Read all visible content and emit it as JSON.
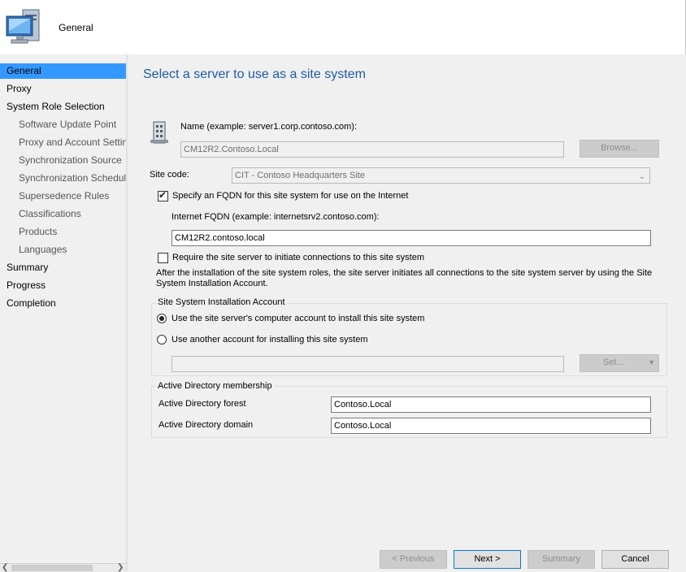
{
  "header": {
    "title": "General",
    "icon": "computer-monitor-icon"
  },
  "nav": {
    "items": [
      {
        "label": "General",
        "level": "top",
        "selected": true
      },
      {
        "label": "Proxy",
        "level": "top",
        "selected": false
      },
      {
        "label": "System Role Selection",
        "level": "top",
        "selected": false
      },
      {
        "label": "Software Update Point",
        "level": "sub",
        "selected": false
      },
      {
        "label": "Proxy and Account Settin",
        "level": "sub",
        "selected": false
      },
      {
        "label": "Synchronization Source",
        "level": "sub",
        "selected": false
      },
      {
        "label": "Synchronization Schedule",
        "level": "sub",
        "selected": false
      },
      {
        "label": "Supersedence Rules",
        "level": "sub",
        "selected": false
      },
      {
        "label": "Classifications",
        "level": "sub",
        "selected": false
      },
      {
        "label": "Products",
        "level": "sub",
        "selected": false
      },
      {
        "label": "Languages",
        "level": "sub",
        "selected": false
      },
      {
        "label": "Summary",
        "level": "top",
        "selected": false
      },
      {
        "label": "Progress",
        "level": "top",
        "selected": false
      },
      {
        "label": "Completion",
        "level": "top",
        "selected": false
      }
    ],
    "scroll_thumb_label": "III"
  },
  "main": {
    "heading": "Select a server to use as a site system",
    "name_label": "Name (example: server1.corp.contoso.com):",
    "name_value": "CM12R2.Contoso.Local",
    "browse_label": "Browse...",
    "site_code_label": "Site code:",
    "site_code_value": "CIT - Contoso Headquarters Site",
    "fqdn_check_label": "Specify an FQDN for this site system for use on the Internet",
    "fqdn_checked": true,
    "internet_fqdn_label": "Internet FQDN (example: internetsrv2.contoso.com):",
    "internet_fqdn_value": "CM12R2.contoso.local",
    "require_check_label": "Require the site server to initiate connections to this site system",
    "require_checked": false,
    "require_note": "After the  installation of the site system roles, the site server initiates all connections to the site system server by using the Site System Installation Account.",
    "install_account_group": "Site System Installation Account",
    "radio_computer_account": "Use the site server's computer account to install this site system",
    "radio_another_account": "Use another account for installing this site system",
    "account_value": "",
    "set_label": "Set...",
    "ad_group": "Active Directory membership",
    "ad_forest_label": "Active Directory forest",
    "ad_forest_value": "Contoso.Local",
    "ad_domain_label": "Active Directory domain",
    "ad_domain_value": "Contoso.Local"
  },
  "footer": {
    "previous_label": "< Previous",
    "next_label": "Next >",
    "summary_label": "Summary",
    "cancel_label": "Cancel"
  }
}
